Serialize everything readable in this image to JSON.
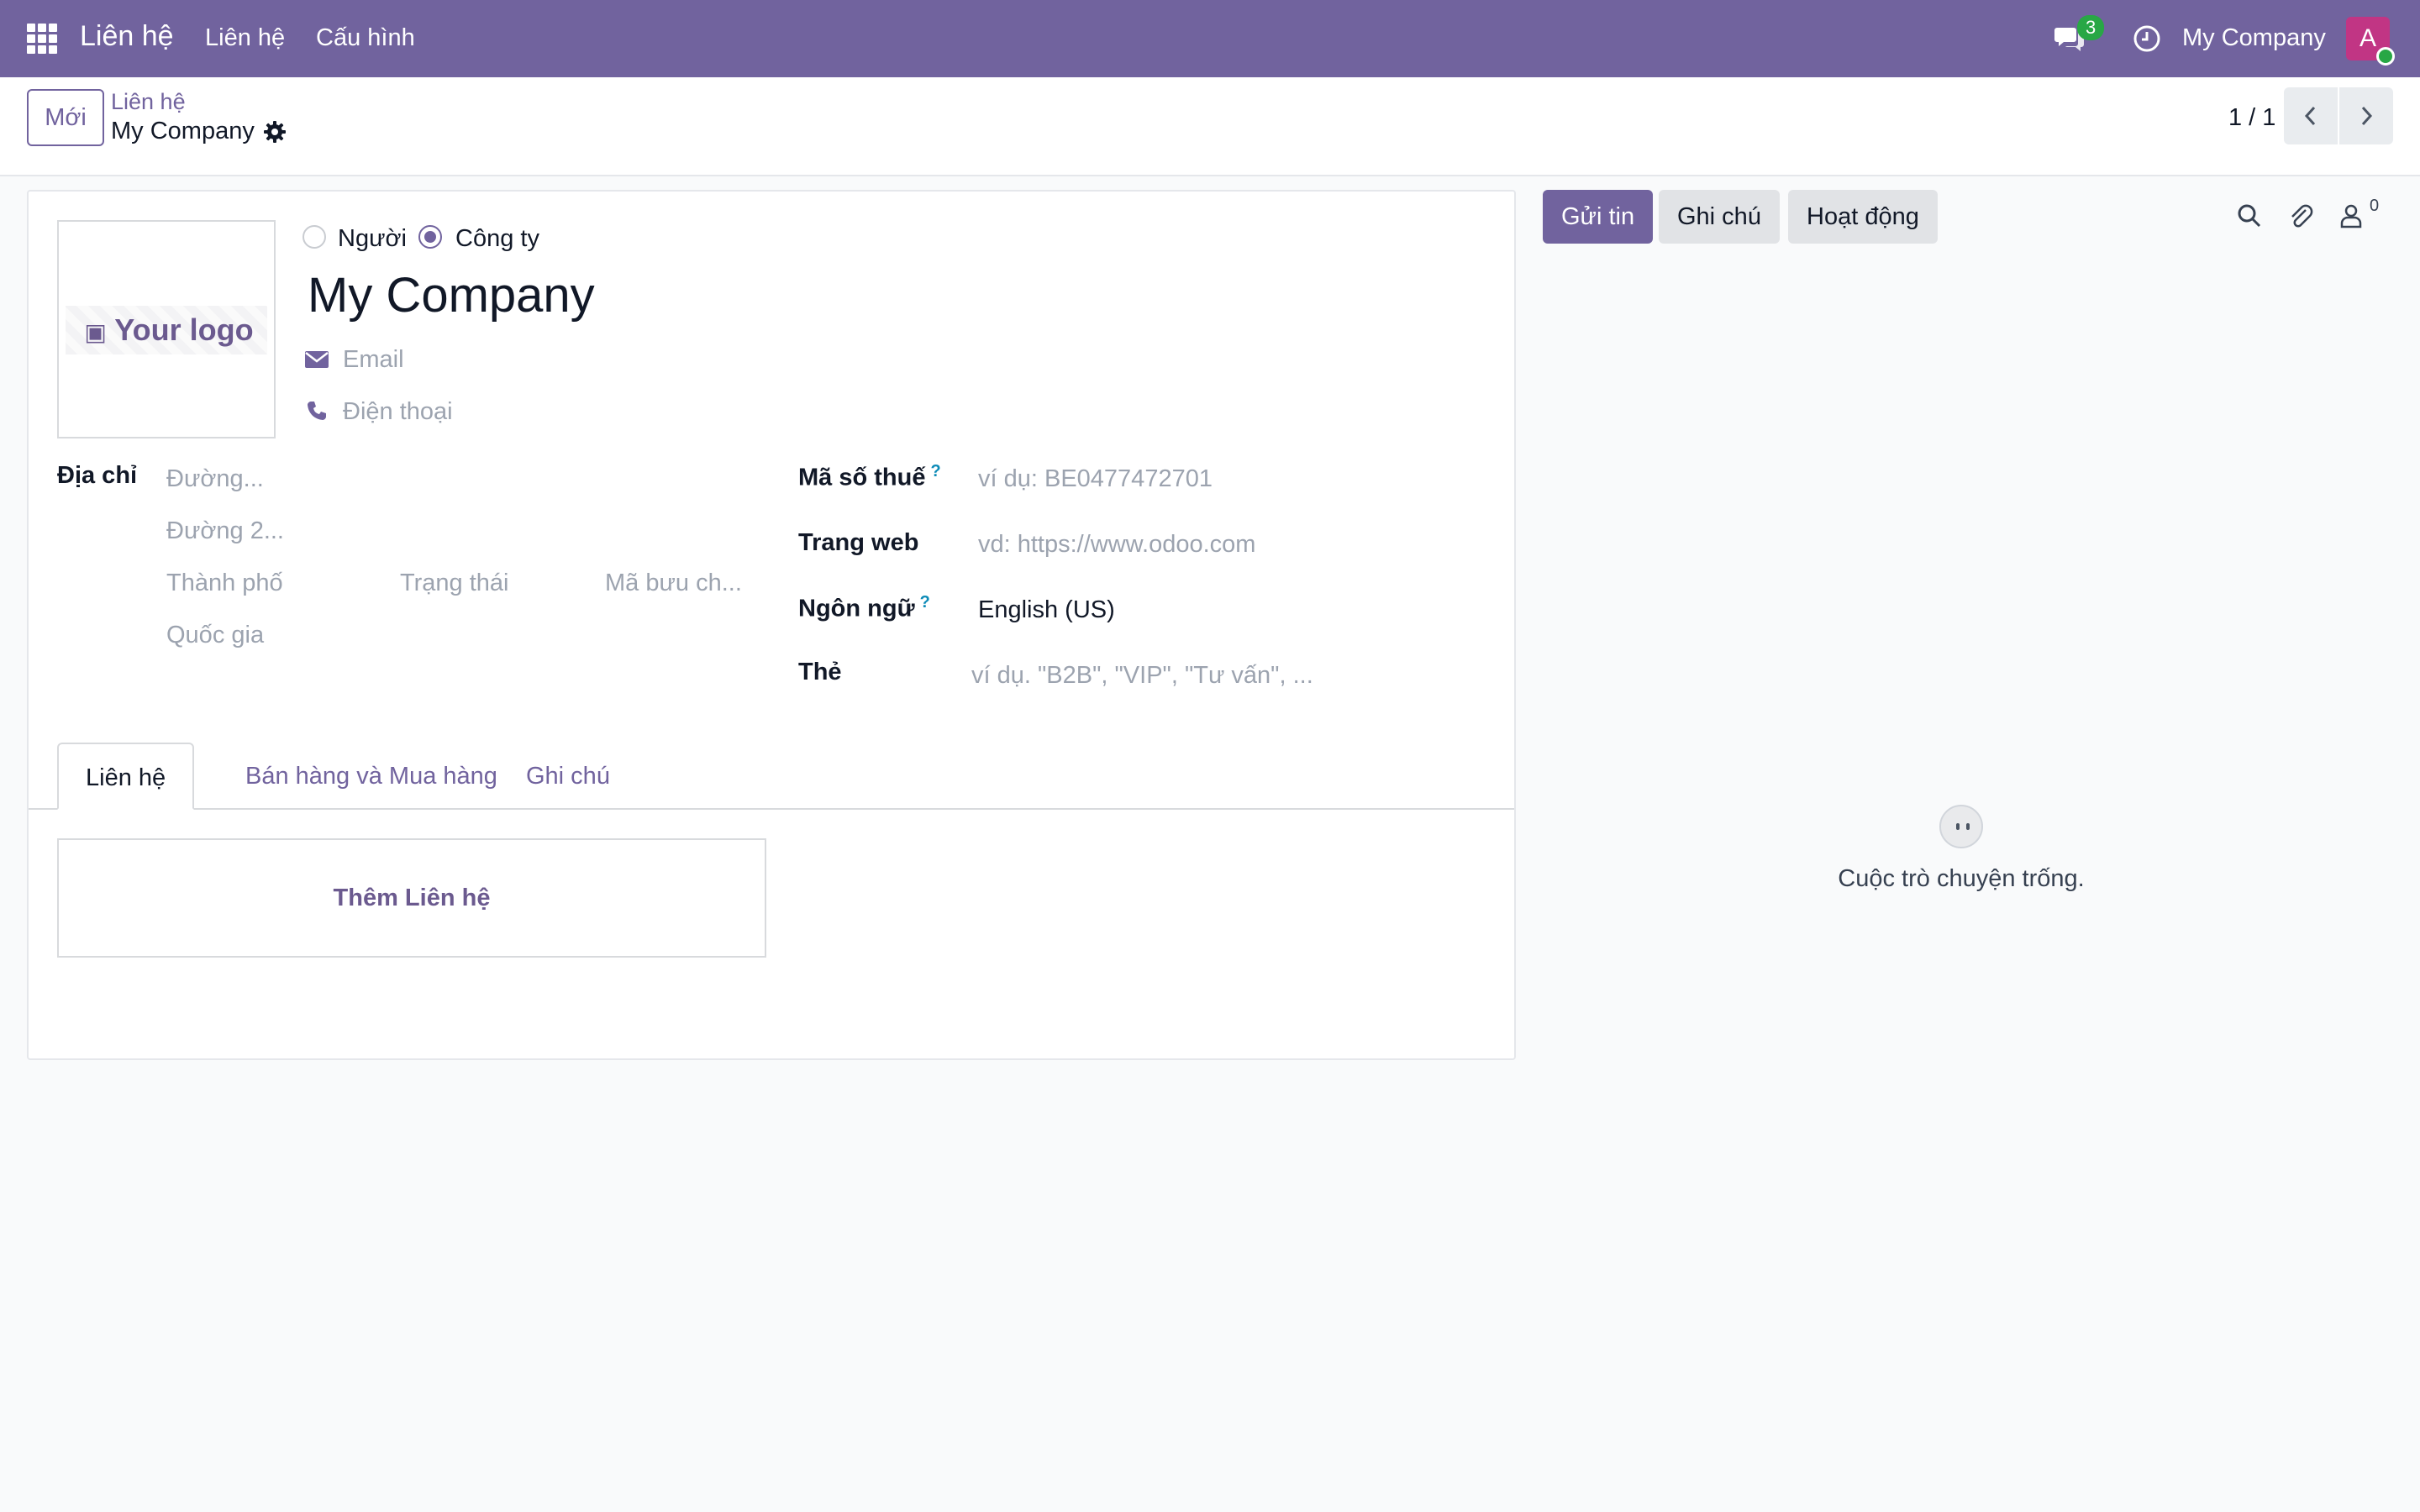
{
  "navbar": {
    "brand": "Liên hệ",
    "menu": [
      "Liên hệ",
      "Cấu hình"
    ],
    "chat_badge": "3",
    "company": "My Company",
    "avatar_letter": "A",
    "color": "#71639e"
  },
  "control_panel": {
    "new_label": "Mới",
    "breadcrumb_parent": "Liên hệ",
    "breadcrumb_current": "My Company",
    "pager": "1 / 1"
  },
  "form": {
    "logo_text": "Your logo",
    "type_person": "Người",
    "type_company": "Công ty",
    "selected_type": "Công ty",
    "name": "My Company",
    "email_placeholder": "Email",
    "phone_placeholder": "Điện thoại",
    "address_label": "Địa chỉ",
    "street_placeholder": "Đường...",
    "street2_placeholder": "Đường 2...",
    "city_placeholder": "Thành phố",
    "state_placeholder": "Trạng thái",
    "zip_placeholder": "Mã bưu ch...",
    "country_placeholder": "Quốc gia",
    "vat_label": "Mã số thuế",
    "vat_placeholder": "ví dụ: BE0477472701",
    "website_label": "Trang web",
    "website_placeholder": "vd: https://www.odoo.com",
    "lang_label": "Ngôn ngữ",
    "lang_value": "English (US)",
    "tags_label": "Thẻ",
    "tags_placeholder": "ví dụ. \"B2B\", \"VIP\", \"Tư vấn\", ...",
    "help_mark": "?"
  },
  "tabs": [
    "Liên hệ",
    "Bán hàng và Mua hàng",
    "Ghi chú"
  ],
  "active_tab": "Liên hệ",
  "add_contact_label": "Thêm Liên hệ",
  "chatter": {
    "send_label": "Gửi tin",
    "note_label": "Ghi chú",
    "activity_label": "Hoạt động",
    "follower_count": "0",
    "empty_text": "Cuộc trò chuyện trống."
  }
}
